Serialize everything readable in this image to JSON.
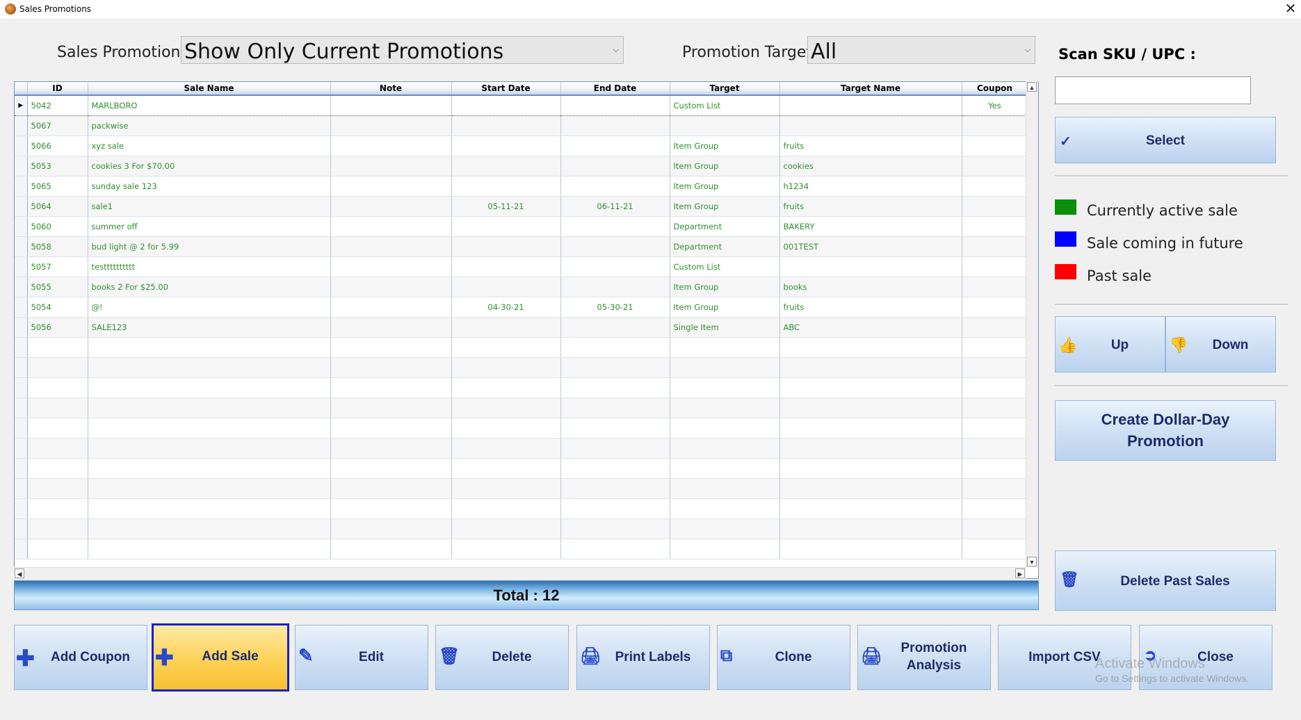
{
  "window": {
    "title": "Sales Promotions",
    "close_glyph": "✕"
  },
  "filters": {
    "promotions_label": "Sales Promotions :",
    "promotions_value": "Show Only Current Promotions",
    "target_label": "Promotion Target :",
    "target_value": "All"
  },
  "grid": {
    "columns": [
      "ID",
      "Sale Name",
      "Note",
      "Start Date",
      "End Date",
      "Target",
      "Target Name",
      "Coupon"
    ],
    "rows": [
      [
        "5042",
        "MARLBORO",
        "",
        "",
        "",
        "Custom List",
        "",
        "Yes"
      ],
      [
        "5067",
        "packwise",
        "",
        "",
        "",
        "",
        "",
        ""
      ],
      [
        "5066",
        "xyz sale",
        "",
        "",
        "",
        "Item Group",
        "fruits",
        ""
      ],
      [
        "5053",
        "cookies 3 For $70.00",
        "",
        "",
        "",
        "Item Group",
        "cookies",
        ""
      ],
      [
        "5065",
        "sunday sale 123",
        "",
        "",
        "",
        "Item Group",
        "h1234",
        ""
      ],
      [
        "5064",
        "sale1",
        "",
        "05-11-21",
        "06-11-21",
        "Item Group",
        "fruits",
        ""
      ],
      [
        "5060",
        "summer off",
        "",
        "",
        "",
        "Department",
        "BAKERY",
        ""
      ],
      [
        "5058",
        "bud light @ 2 for 5.99",
        "",
        "",
        "",
        "Department",
        "001TEST",
        ""
      ],
      [
        "5057",
        "testttttttttt",
        "",
        "",
        "",
        "Custom List",
        "",
        ""
      ],
      [
        "5055",
        "books 2 For $25.00",
        "",
        "",
        "",
        "Item Group",
        "books",
        ""
      ],
      [
        "5054",
        "@!",
        "",
        "04-30-21",
        "05-30-21",
        "Item Group",
        "fruits",
        ""
      ],
      [
        "5056",
        "SALE123",
        "",
        "",
        "",
        "Single Item",
        "ABC",
        ""
      ]
    ],
    "empty_rows": 11,
    "selected_row_marker": "▶",
    "text_color": "#2f8f2f"
  },
  "total": "Total : 12",
  "right_panel": {
    "scan_label": "Scan SKU / UPC :",
    "scan_value": "",
    "select_label": "Select",
    "select_icon": "check-icon",
    "legend": [
      {
        "label": "Currently active sale",
        "color": "#0a8f0a"
      },
      {
        "label": "Sale coming in future",
        "color": "#0000ff"
      },
      {
        "label": "Past sale",
        "color": "#ff0000"
      }
    ],
    "up_label": "Up",
    "down_label": "Down",
    "dollar_day_line1": "Create Dollar-Day",
    "dollar_day_line2": "Promotion",
    "delete_past_label": "Delete Past Sales"
  },
  "toolbar": {
    "add_coupon": "Add Coupon",
    "add_sale": "Add Sale",
    "edit": "Edit",
    "delete": "Delete",
    "print_labels": "Print Labels",
    "clone": "Clone",
    "promotion_analysis_line1": "Promotion",
    "promotion_analysis_line2": "Analysis",
    "import_csv": "Import CSV",
    "close": "Close"
  },
  "watermark": {
    "line1": "Activate Windows",
    "line2": "Go to Settings to activate Windows."
  },
  "colors": {
    "button_text": "#1d2a6b",
    "active_button": "#ffd257",
    "active_border": "#1421c8"
  }
}
